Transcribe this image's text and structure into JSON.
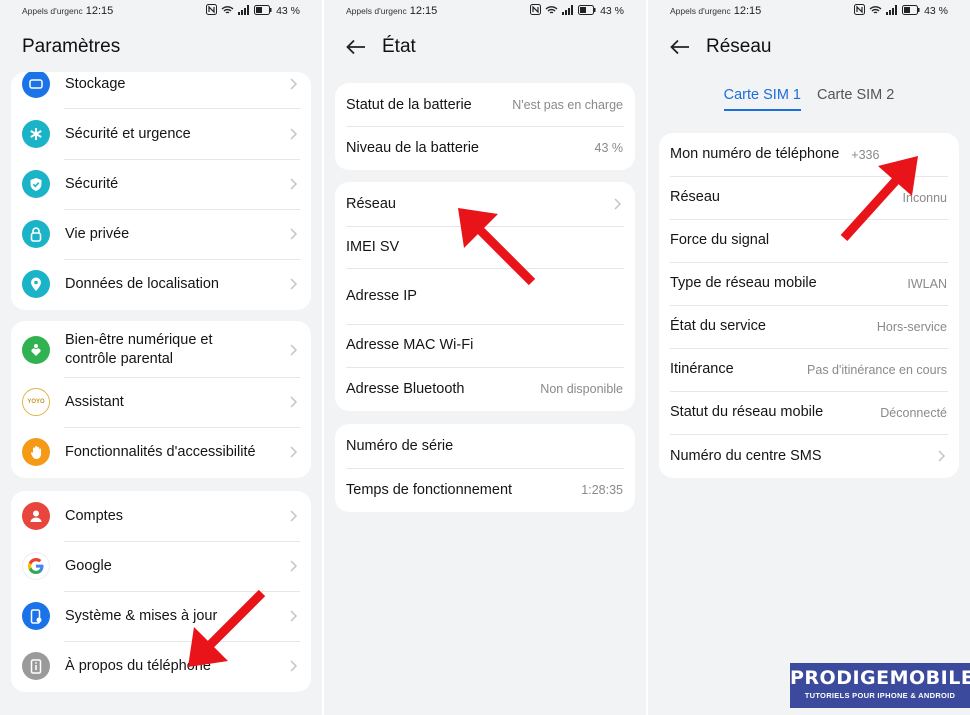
{
  "statusbar": {
    "carrier": "Appels d'urgenc",
    "time": "12:15",
    "battery": "43 %"
  },
  "settings": {
    "title": "Paramètres",
    "group1": [
      {
        "label": "Stockage",
        "icon": "storage-icon",
        "color": "#1a73e8"
      },
      {
        "label": "Sécurité et urgence",
        "icon": "asterisk-icon",
        "color": "#1ab3c7"
      },
      {
        "label": "Sécurité",
        "icon": "shield-check-icon",
        "color": "#1ab3c7"
      },
      {
        "label": "Vie privée",
        "icon": "lock-icon",
        "color": "#1ab3c7"
      },
      {
        "label": "Données de localisation",
        "icon": "location-pin-icon",
        "color": "#1ab3c7"
      }
    ],
    "group2": [
      {
        "label": "Bien-être numérique et contrôle parental",
        "icon": "heart-person-icon",
        "color": "#2fb24f"
      },
      {
        "label": "Assistant",
        "icon": "assistant-icon",
        "color": "#ffffff",
        "badge": "YOYO"
      },
      {
        "label": "Fonctionnalités d'accessibilité",
        "icon": "hand-icon",
        "color": "#f59a16"
      }
    ],
    "group3": [
      {
        "label": "Comptes",
        "icon": "person-icon",
        "color": "#e8453c"
      },
      {
        "label": "Google",
        "icon": "google-icon",
        "color": "#ffffff"
      },
      {
        "label": "Système & mises à jour",
        "icon": "phone-settings-icon",
        "color": "#1a73e8"
      },
      {
        "label": "À propos du téléphone",
        "icon": "info-phone-icon",
        "color": "#9a9a9a"
      }
    ]
  },
  "etat": {
    "title": "État",
    "group1": [
      {
        "label": "Statut de la batterie",
        "value": "N'est pas en charge"
      },
      {
        "label": "Niveau de la batterie",
        "value": "43 %"
      }
    ],
    "group2": [
      {
        "label": "Réseau",
        "value": ""
      },
      {
        "label": "IMEI SV",
        "value": ""
      },
      {
        "label": "Adresse IP",
        "value": ""
      },
      {
        "label": "Adresse MAC Wi-Fi",
        "value": ""
      },
      {
        "label": "Adresse Bluetooth",
        "value": "Non disponible"
      }
    ],
    "group3": [
      {
        "label": "Numéro de série",
        "value": ""
      },
      {
        "label": "Temps de fonctionnement",
        "value": "1:28:35"
      }
    ]
  },
  "reseau": {
    "title": "Réseau",
    "tabs": [
      "Carte SIM 1",
      "Carte SIM 2"
    ],
    "rows": [
      {
        "label": "Mon numéro de téléphone",
        "value": "+336"
      },
      {
        "label": "Réseau",
        "value": "Inconnu"
      },
      {
        "label": "Force du signal",
        "value": ""
      },
      {
        "label": "Type de réseau mobile",
        "value": "IWLAN"
      },
      {
        "label": "État du service",
        "value": "Hors-service"
      },
      {
        "label": "Itinérance",
        "value": "Pas d'itinérance en cours"
      },
      {
        "label": "Statut du réseau mobile",
        "value": "Déconnecté"
      },
      {
        "label": "Numéro du centre SMS",
        "value": ""
      }
    ]
  },
  "logo": {
    "brand": "PRODIGEMOBILE",
    "tagline": "TUTORIELS POUR IPHONE & ANDROID"
  },
  "colors": {
    "accent": "#1a6fd8",
    "annotation": "#e8141a",
    "logo_bg": "#3b4a9c"
  }
}
